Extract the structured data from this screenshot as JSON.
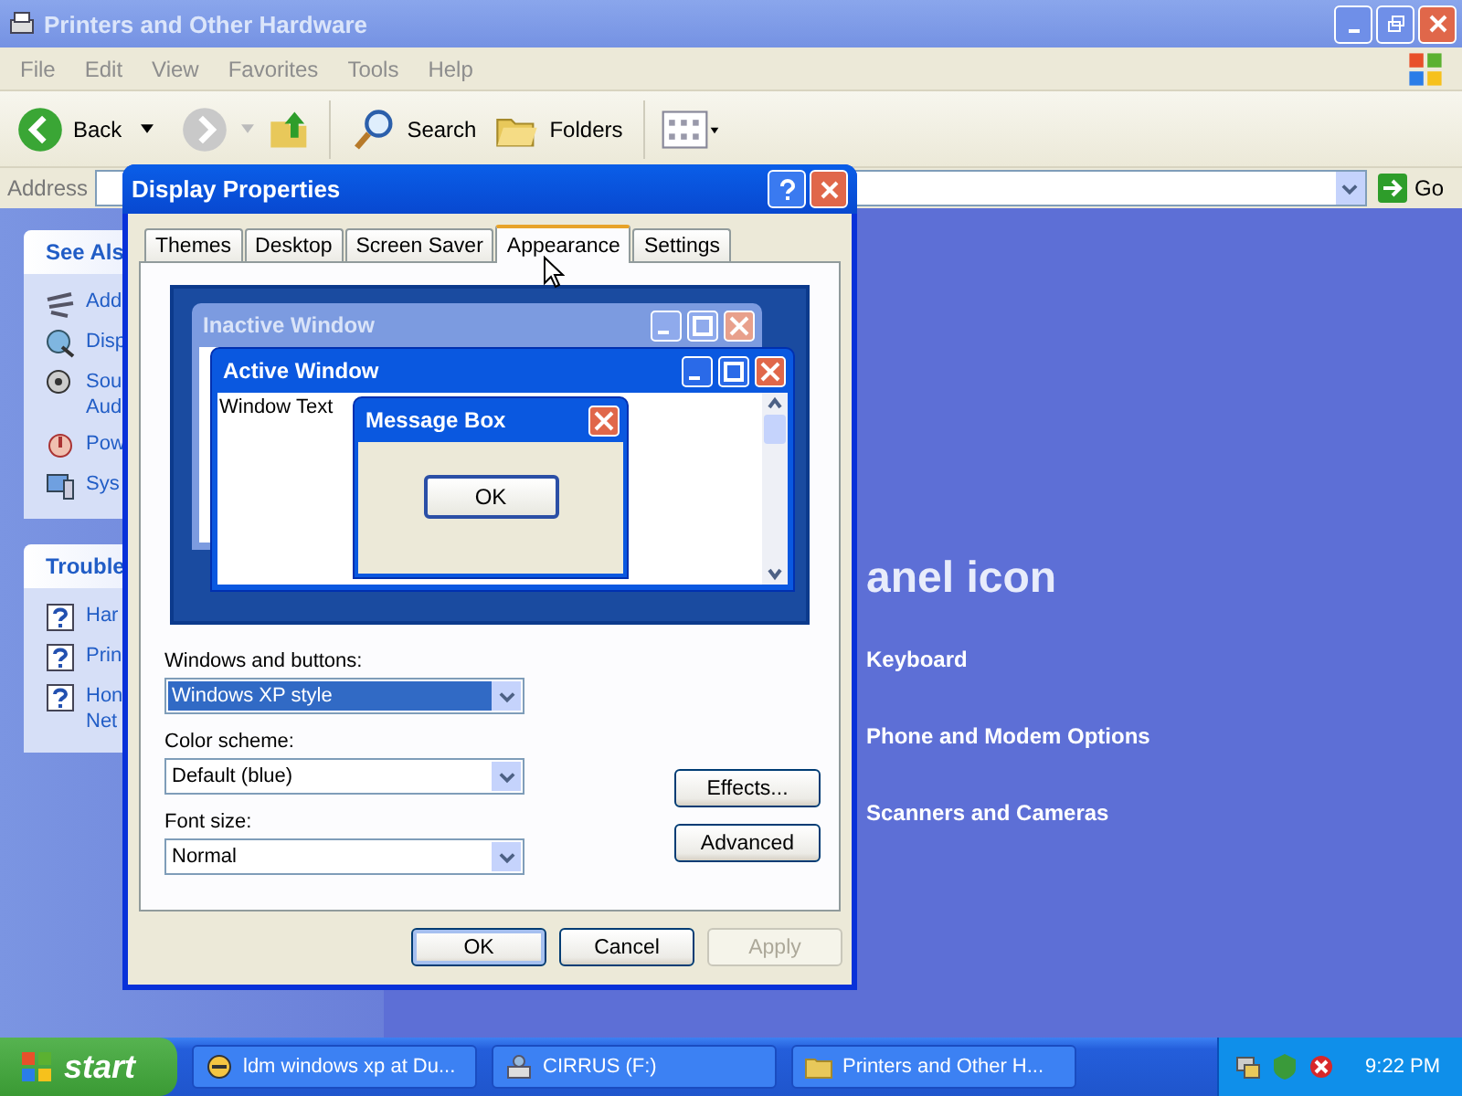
{
  "explorer": {
    "title": "Printers and Other Hardware",
    "menu": [
      "File",
      "Edit",
      "View",
      "Favorites",
      "Tools",
      "Help"
    ],
    "toolbar": {
      "back": "Back",
      "search": "Search",
      "folders": "Folders"
    },
    "address": {
      "label": "Address",
      "go": "Go"
    },
    "sidebar": [
      {
        "title": "See Als",
        "items": [
          {
            "kind": "wires",
            "lines": [
              "Add"
            ]
          },
          {
            "kind": "display",
            "lines": [
              "Disp"
            ]
          },
          {
            "kind": "sound",
            "lines": [
              "Sou",
              "Aud"
            ]
          },
          {
            "kind": "power",
            "lines": [
              "Pow"
            ]
          },
          {
            "kind": "system",
            "lines": [
              "Sys"
            ]
          }
        ]
      },
      {
        "title": "Trouble",
        "items": [
          {
            "kind": "help",
            "lines": [
              "Har"
            ]
          },
          {
            "kind": "help",
            "lines": [
              "Prin"
            ]
          },
          {
            "kind": "help",
            "lines": [
              "Hon",
              "Net"
            ]
          }
        ]
      }
    ],
    "main": {
      "heading": "anel icon",
      "items": [
        "Keyboard",
        "Phone and Modem Options",
        "Scanners and Cameras"
      ]
    }
  },
  "dialog": {
    "title": "Display Properties",
    "tabs": [
      {
        "label": "Themes",
        "selected": false
      },
      {
        "label": "Desktop",
        "selected": false
      },
      {
        "label": "Screen Saver",
        "selected": false
      },
      {
        "label": "Appearance",
        "selected": true
      },
      {
        "label": "Settings",
        "selected": false
      }
    ],
    "preview": {
      "inactive_title": "Inactive Window",
      "active_title": "Active Window",
      "window_text": "Window Text",
      "message_title": "Message Box",
      "message_ok": "OK"
    },
    "fields": [
      {
        "label": "Windows and buttons:",
        "value": "Windows XP style",
        "focused": true
      },
      {
        "label": "Color scheme:",
        "value": "Default (blue)",
        "focused": false
      },
      {
        "label": "Font size:",
        "value": "Normal",
        "focused": false
      }
    ],
    "side_buttons": [
      "Effects...",
      "Advanced"
    ],
    "buttons": [
      {
        "label": "OK",
        "default": true,
        "disabled": false
      },
      {
        "label": "Cancel",
        "default": false,
        "disabled": false
      },
      {
        "label": "Apply",
        "default": false,
        "disabled": true
      }
    ]
  },
  "taskbar": {
    "start": "start",
    "tasks": [
      {
        "kind": "app",
        "label": "ldm windows xp at Du..."
      },
      {
        "kind": "drive",
        "label": "CIRRUS (F:)"
      },
      {
        "kind": "folder",
        "label": "Printers and Other H..."
      }
    ],
    "clock": "9:22 PM"
  }
}
